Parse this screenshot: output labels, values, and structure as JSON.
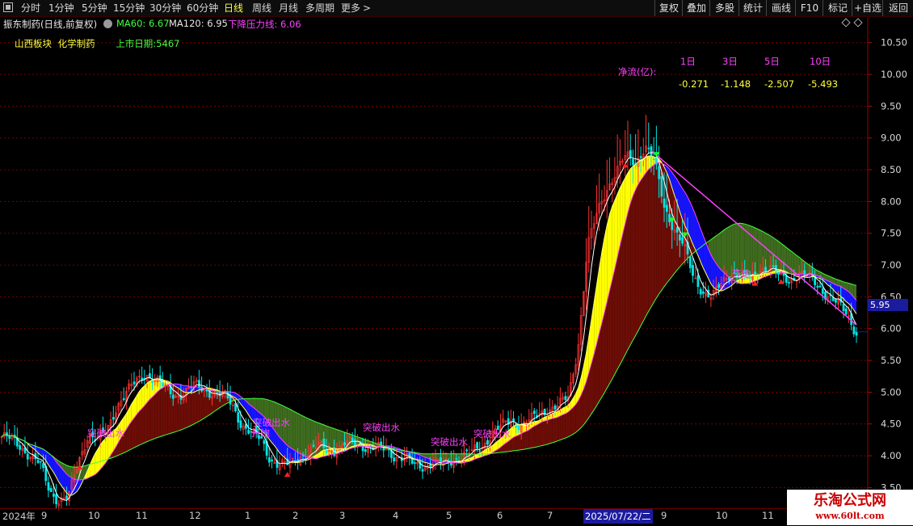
{
  "toolbar": {
    "periods": [
      "分时",
      "1分钟",
      "5分钟",
      "15分钟",
      "30分钟",
      "60分钟",
      "日线",
      "周线",
      "月线",
      "多周期",
      "更多"
    ],
    "active": "日线",
    "more_arrow": ">",
    "right_tools": [
      "复权",
      "叠加",
      "多股",
      "统计",
      "画线",
      "F10",
      "标记",
      "+自选",
      "返回"
    ]
  },
  "header": {
    "stock_title": "振东制药(日线,前复权)",
    "ma60": "MA60: 6.67",
    "ma120": "MA120: 6.95",
    "pressure": "下降压力线: 6.06"
  },
  "info": {
    "sector": "山西板块",
    "industry": "化学制药",
    "listing_days": "上市日期:5467"
  },
  "net_flow": {
    "label": "净流(亿):",
    "periods": [
      "1日",
      "3日",
      "5日",
      "10日"
    ],
    "values": [
      "-0.271",
      "-1.148",
      "-2.507",
      "-5.493"
    ]
  },
  "annotations": [
    "突破出水",
    "开炮"
  ],
  "current_price": "5.95",
  "date_axis": {
    "labels": [
      "2024年",
      "9",
      "10",
      "11",
      "12",
      "1",
      "2",
      "3",
      "4",
      "5",
      "6",
      "7",
      "2025/07/22/二",
      "9",
      "10",
      "11"
    ],
    "cursor_date": "2025/07/22/二"
  },
  "watermark": {
    "line1": "乐淘公式网",
    "line2": "www.60lt.com"
  },
  "colors": {
    "up": "#ff3232",
    "down": "#00e5e5",
    "yellow_band": "#ffff00",
    "blue_band": "#1414ff",
    "brown_fill": "#6b0d06",
    "green_fill": "#3e6b1e",
    "magenta": "#ff40ff",
    "grid": "#7a0000"
  },
  "chart_data": {
    "type": "candlestick",
    "y_ticks": [
      3.5,
      4.0,
      4.5,
      5.0,
      5.5,
      6.0,
      6.5,
      7.0,
      7.5,
      8.0,
      8.5,
      9.0,
      9.5,
      10.0,
      10.5
    ],
    "ylim": [
      3.2,
      10.7
    ],
    "x_labels": [
      "2024年",
      "9",
      "10",
      "11",
      "12",
      "1",
      "2",
      "3",
      "4",
      "5",
      "6",
      "7",
      "2025/07/22/二",
      "9",
      "10",
      "11"
    ],
    "close_path": [
      4.3,
      4.25,
      4.15,
      4.0,
      3.85,
      3.45,
      3.3,
      3.35,
      3.9,
      4.35,
      4.25,
      4.4,
      4.8,
      5.0,
      5.15,
      5.3,
      5.2,
      5.05,
      4.95,
      5.0,
      5.1,
      5.05,
      5.0,
      4.95,
      4.8,
      4.5,
      4.35,
      4.25,
      3.95,
      3.85,
      3.85,
      4.0,
      4.05,
      4.15,
      4.1,
      4.1,
      4.2,
      4.2,
      4.15,
      4.1,
      4.1,
      4.0,
      3.95,
      3.85,
      3.85,
      3.9,
      3.85,
      3.95,
      4.0,
      4.05,
      4.15,
      4.35,
      4.45,
      4.55,
      4.5,
      4.55,
      4.65,
      4.75,
      4.8,
      4.9,
      5.7,
      7.3,
      7.8,
      8.2,
      8.5,
      8.7,
      8.6,
      8.9,
      8.6,
      7.9,
      7.6,
      7.3,
      6.8,
      6.6,
      6.5,
      6.7,
      6.9,
      6.85,
      6.75,
      6.95,
      7.0,
      6.8,
      6.75,
      6.9,
      6.8,
      6.65,
      6.55,
      6.4,
      6.2,
      5.95
    ]
  }
}
